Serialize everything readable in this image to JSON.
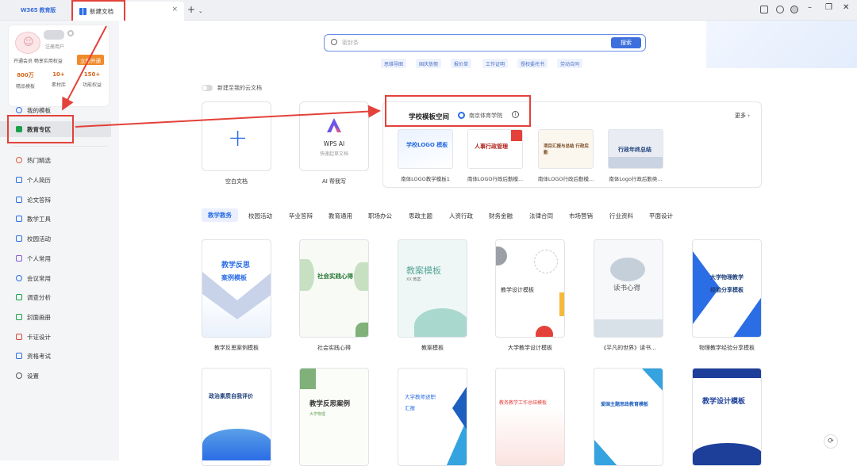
{
  "tabbar": {
    "app_tab": "W365 教育版",
    "doc_tab": "新建文档",
    "new_tab_symbol": "+",
    "dropdown_symbol": "⌄"
  },
  "sidebar": {
    "user_status": "注册用户",
    "promo": "开通会员 畅享实用权益",
    "open_btn": "立即开通",
    "stats": [
      {
        "value": "800万",
        "label": "精品模板"
      },
      {
        "value": "10+",
        "label": "素材库"
      },
      {
        "value": "150+",
        "label": "功能权益"
      }
    ],
    "top_items": [
      "我的模板",
      "教育专区"
    ],
    "items": [
      "热门精选",
      "个人简历",
      "论文答辩",
      "教学工具",
      "校园活动",
      "个人常用",
      "会议常用",
      "调查分析",
      "封面画册",
      "卡证设计",
      "资格考试",
      "设置"
    ]
  },
  "search": {
    "placeholder": "密封条",
    "button": "搜索",
    "tags": [
      "思维导图",
      "国庆放假",
      "报价单",
      "工作证明",
      "授权委托书",
      "劳动合同"
    ]
  },
  "cloud_toggle": "新建至我的云文档",
  "blank_doc": "空白文档",
  "ai_card": {
    "title": "WPS AI",
    "subtitle": "快速起草文档",
    "label": "AI 帮我写"
  },
  "school_panel": {
    "title": "学校模板空间",
    "school": "南京体育学院",
    "info": "i",
    "more": "更多 ›",
    "thumbs": [
      {
        "caption": "南体LOGO教学模板1",
        "text": "学校LOGO 模板"
      },
      {
        "caption": "南体LOGO行政后勤模...",
        "text": "人事行政管理"
      },
      {
        "caption": "南体LOGO行政后勤模...",
        "text": "项目汇报与总结 行政后勤"
      },
      {
        "caption": "南体Logo行政后勤类...",
        "text": "行政年终总结"
      }
    ]
  },
  "categories": [
    "教学教务",
    "校园活动",
    "毕业答辩",
    "教育通用",
    "职场办公",
    "思政主题",
    "人资行政",
    "财务金融",
    "法律合同",
    "市场营销",
    "行业资料",
    "平面设计"
  ],
  "templates_row1": [
    {
      "caption": "教学反思案例模板",
      "title": "教学反思",
      "sub": "案例模板"
    },
    {
      "caption": "社会实践心得",
      "title": "社会实践心得"
    },
    {
      "caption": "教案模板",
      "title": "教案模板",
      "sub": "XX 教案"
    },
    {
      "caption": "大学教学设计模板",
      "title": "教学设计模板"
    },
    {
      "caption": "《平凡的世界》读书...",
      "title": "读书心得"
    },
    {
      "caption": "物理教学经验分享模板",
      "title": "大学物理教学",
      "sub": "经验分享模板"
    }
  ],
  "templates_row2": [
    {
      "title": "政治素质自我评价"
    },
    {
      "title": "教学反思案例",
      "sub": "大学物理"
    },
    {
      "title": "大学教师述职",
      "sub": "汇报"
    },
    {
      "title": "教务教学工作总结模板"
    },
    {
      "title": "爱国主题思政教育模板"
    },
    {
      "title": "教学设计模板"
    }
  ],
  "float_icon": "⟳",
  "colors": {
    "accent": "#2b6de5",
    "annotation": "#e3413a",
    "promo": "#f08a2b"
  }
}
